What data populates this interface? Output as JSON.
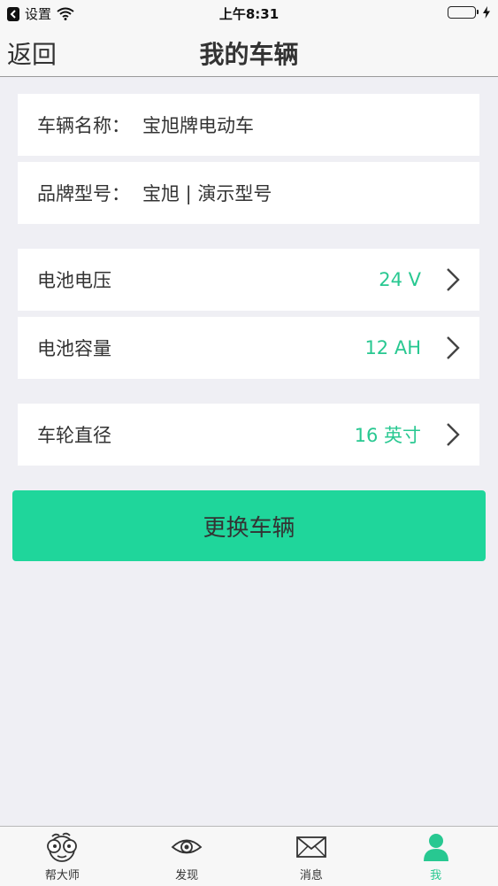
{
  "status_bar": {
    "carrier": "设置",
    "time": "上午8:31"
  },
  "nav": {
    "back_label": "返回",
    "title": "我的车辆"
  },
  "info": [
    {
      "label": "车辆名称：",
      "value": "宝旭牌电动车"
    },
    {
      "label": "品牌型号：",
      "value": "宝旭 | 演示型号"
    }
  ],
  "settings": [
    {
      "label": "电池电压",
      "value": "24 V"
    },
    {
      "label": "电池容量",
      "value": "12 AH"
    },
    {
      "label": "车轮直径",
      "value": "16 英寸"
    }
  ],
  "action": {
    "label": "更换车辆"
  },
  "tabs": [
    {
      "label": "帮大师",
      "icon": "mascot-icon"
    },
    {
      "label": "发现",
      "icon": "eye-icon"
    },
    {
      "label": "消息",
      "icon": "envelope-icon"
    },
    {
      "label": "我",
      "icon": "person-icon",
      "active": true
    }
  ],
  "colors": {
    "accent": "#1fd69b",
    "value_text": "#28c891",
    "background": "#efeff4"
  }
}
